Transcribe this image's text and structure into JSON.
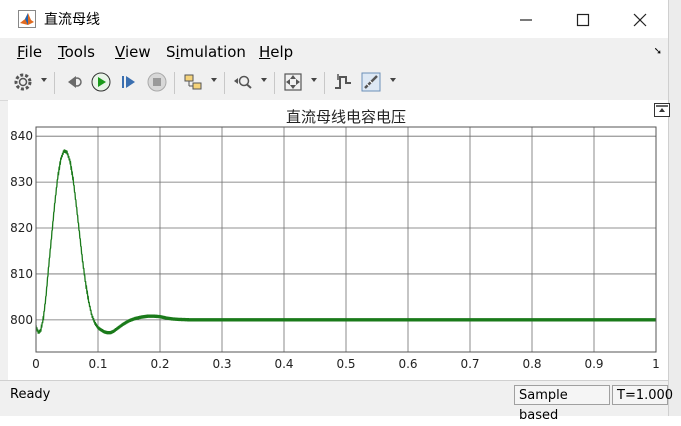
{
  "window": {
    "title": "直流母线"
  },
  "menu": {
    "file": "F",
    "file_rest": "ile",
    "tools": "T",
    "tools_rest": "ools",
    "view": "V",
    "view_rest": "iew",
    "simulation_pre": "S",
    "simulation_u": "i",
    "simulation_rest": "mulation",
    "help": "H",
    "help_rest": "elp"
  },
  "status": {
    "text": "Ready",
    "mode": "Sample based",
    "time": "T=1.000"
  },
  "colors": {
    "trace": "#1a7a1a",
    "accent": "#0066cc"
  },
  "chart_data": {
    "type": "line",
    "title": "直流母线电容电压",
    "xlabel": "",
    "ylabel": "",
    "xlim": [
      0,
      1
    ],
    "ylim": [
      793,
      842
    ],
    "xticks": [
      "0",
      "0.1",
      "0.2",
      "0.3",
      "0.4",
      "0.5",
      "0.6",
      "0.7",
      "0.8",
      "0.9",
      "1"
    ],
    "yticks": [
      "800",
      "810",
      "820",
      "830",
      "840"
    ],
    "grid": true,
    "series": [
      {
        "color": "#1a7a1a",
        "x": [
          0,
          0.004,
          0.008,
          0.012,
          0.016,
          0.02,
          0.025,
          0.03,
          0.035,
          0.04,
          0.045,
          0.05,
          0.055,
          0.06,
          0.065,
          0.07,
          0.075,
          0.08,
          0.085,
          0.09,
          0.095,
          0.1,
          0.105,
          0.11,
          0.115,
          0.12,
          0.125,
          0.13,
          0.14,
          0.15,
          0.16,
          0.17,
          0.18,
          0.19,
          0.2,
          0.21,
          0.22,
          0.23,
          0.25,
          0.3,
          0.4,
          0.5,
          0.6,
          0.7,
          0.8,
          0.9,
          1.0
        ],
        "y": [
          798.5,
          797.2,
          797.8,
          800.5,
          805,
          811,
          818,
          825,
          831,
          835,
          836.8,
          836.5,
          834.5,
          830.5,
          825,
          819,
          813,
          808,
          804,
          801,
          799.3,
          798.3,
          797.8,
          797.4,
          797.2,
          797.2,
          797.5,
          798,
          799,
          799.8,
          800.3,
          800.6,
          800.8,
          800.8,
          800.7,
          800.4,
          800.2,
          800.1,
          800,
          800,
          800,
          800,
          800,
          800,
          800,
          800,
          800
        ]
      }
    ]
  }
}
